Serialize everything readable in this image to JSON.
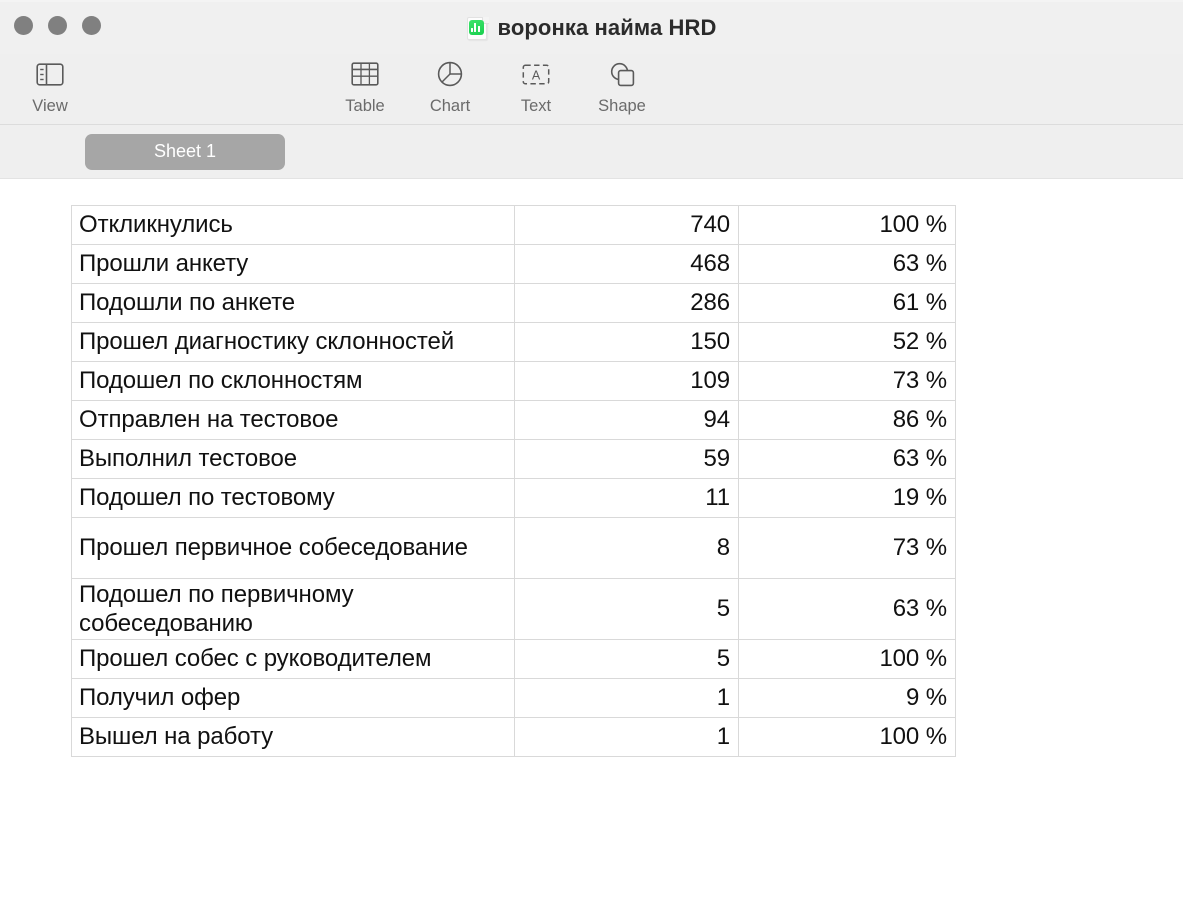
{
  "window": {
    "title": "воронка найма HRD",
    "doc_icon": "numbers-document-icon",
    "traffic_lights": [
      "close-button",
      "minimize-button",
      "zoom-button"
    ]
  },
  "toolbar": {
    "items": [
      {
        "label": "View",
        "icon": "sidebar-icon"
      },
      {
        "label": "Table",
        "icon": "table-grid-icon"
      },
      {
        "label": "Chart",
        "icon": "pie-chart-icon"
      },
      {
        "label": "Text",
        "icon": "text-box-icon"
      },
      {
        "label": "Shape",
        "icon": "shapes-icon"
      }
    ]
  },
  "sheetbar": {
    "tabs": [
      {
        "label": "Sheet 1",
        "active": true
      }
    ]
  },
  "table": {
    "columns": [
      "stage",
      "count",
      "conversion"
    ],
    "rows": [
      {
        "label": "Откликнулись",
        "count": "740",
        "pct": "100 %",
        "tall": false
      },
      {
        "label": "Прошли анкету",
        "count": "468",
        "pct": "63 %",
        "tall": false
      },
      {
        "label": "Подошли по анкете",
        "count": "286",
        "pct": "61 %",
        "tall": false
      },
      {
        "label": "Прошел диагностику склонностей",
        "count": "150",
        "pct": "52 %",
        "tall": false
      },
      {
        "label": "Подошел по склонностям",
        "count": "109",
        "pct": "73 %",
        "tall": false
      },
      {
        "label": "Отправлен на тестовое",
        "count": "94",
        "pct": "86 %",
        "tall": false
      },
      {
        "label": "Выполнил тестовое",
        "count": "59",
        "pct": "63 %",
        "tall": false
      },
      {
        "label": "Подошел по тестовому",
        "count": "11",
        "pct": "19 %",
        "tall": false
      },
      {
        "label": "Прошел первичное собеседование",
        "count": "8",
        "pct": "73 %",
        "tall": true
      },
      {
        "label": "Подошел по первичному собеседованию",
        "count": "5",
        "pct": "63 %",
        "tall": true
      },
      {
        "label": "Прошел собес с руководителем",
        "count": "5",
        "pct": "100 %",
        "tall": false
      },
      {
        "label": "Получил офер",
        "count": "1",
        "pct": "9 %",
        "tall": false
      },
      {
        "label": "Вышел на работу",
        "count": "1",
        "pct": "100 %",
        "tall": false
      }
    ]
  },
  "colors": {
    "chrome": "#efefef",
    "titlebar": "#f0f0f0",
    "tab_active": "#a6a6a6",
    "grid_line": "#d9d9d9",
    "icon_green": "#18cf4e",
    "text": "#111111",
    "toolbar_label": "#6b6b6b"
  }
}
